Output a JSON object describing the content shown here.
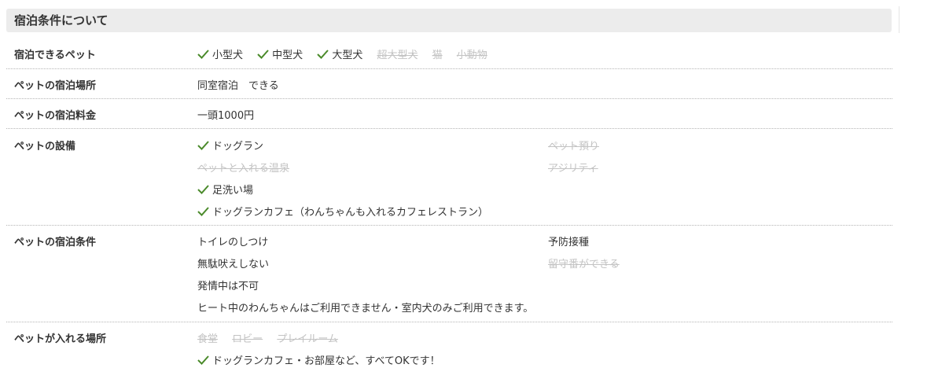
{
  "section": {
    "title": "宿泊条件について"
  },
  "colors": {
    "check": "#4a8a2a",
    "disabled": "#c3c3c3",
    "header_bg": "#ececec"
  },
  "rows": {
    "pet_types": {
      "label": "宿泊できるペット",
      "items": [
        {
          "text": "小型犬",
          "ok": true
        },
        {
          "text": "中型犬",
          "ok": true
        },
        {
          "text": "大型犬",
          "ok": true
        },
        {
          "text": "超大型犬",
          "ok": false
        },
        {
          "text": "猫",
          "ok": false
        },
        {
          "text": "小動物",
          "ok": false
        }
      ]
    },
    "place": {
      "label": "ペットの宿泊場所",
      "value": "同室宿泊　できる"
    },
    "fee": {
      "label": "ペットの宿泊料金",
      "value": "一頭1000円"
    },
    "facilities": {
      "label": "ペットの設備",
      "items": [
        {
          "text": "ドッグラン",
          "ok": true
        },
        {
          "text": "ペット預り",
          "ok": false
        },
        {
          "text": "ペットと入れる温泉",
          "ok": false
        },
        {
          "text": "アジリティ",
          "ok": false
        },
        {
          "text": "足洗い場",
          "ok": true
        },
        {
          "text": "ドッグランカフェ（わんちゃんも入れるカフェレストラン）",
          "ok": true
        }
      ]
    },
    "conditions": {
      "label": "ペットの宿泊条件",
      "items": [
        {
          "text": "トイレのしつけ",
          "ok": true
        },
        {
          "text": "予防接種",
          "ok": true
        },
        {
          "text": "無駄吠えしない",
          "ok": true
        },
        {
          "text": "留守番ができる",
          "ok": false
        },
        {
          "text": "発情中は不可",
          "ok": true
        },
        {
          "text": "ヒート中のわんちゃんはご利用できません・室内犬のみご利用できます。",
          "ok": true
        }
      ]
    },
    "areas": {
      "label": "ペットが入れる場所",
      "items": [
        {
          "text": "食堂",
          "ok": false
        },
        {
          "text": "ロビー",
          "ok": false
        },
        {
          "text": "プレイルーム",
          "ok": false
        }
      ],
      "note": "ドッグランカフェ・お部屋など、すべてOKです！"
    }
  }
}
